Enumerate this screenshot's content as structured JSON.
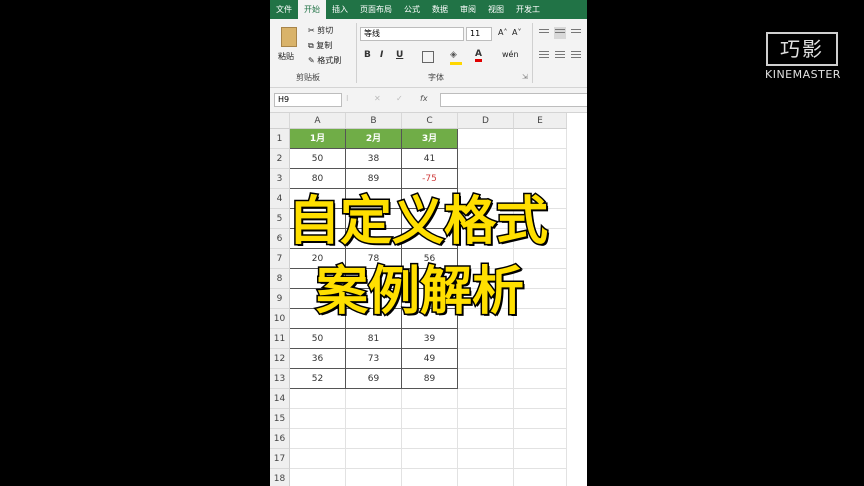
{
  "ribbon": {
    "tabs": [
      "文件",
      "开始",
      "插入",
      "页面布局",
      "公式",
      "数据",
      "审阅",
      "视图",
      "开发工"
    ],
    "active_tab": "开始",
    "clipboard": {
      "paste": "粘贴",
      "cut": "剪切",
      "copy": "复制",
      "format_painter": "格式刷",
      "group_label": "剪贴板"
    },
    "font": {
      "name": "等线",
      "size": "11",
      "group_label": "字体",
      "bold": "B",
      "italic": "I",
      "underline": "U",
      "fx_color": "A"
    },
    "accent_color": "#217346"
  },
  "formula_bar": {
    "name_box": "H9",
    "fx": "fx",
    "cancel": "✕",
    "enter": "✓"
  },
  "grid": {
    "columns": [
      "A",
      "B",
      "C",
      "D",
      "E"
    ],
    "rows": [
      "1",
      "2",
      "3",
      "4",
      "5",
      "6",
      "7",
      "8",
      "9",
      "10",
      "11",
      "12",
      "13",
      "14",
      "15",
      "16",
      "17",
      "18"
    ],
    "header": [
      "1月",
      "2月",
      "3月"
    ],
    "header_color": "#70ad47",
    "cells": [
      [
        "50",
        "38",
        "41"
      ],
      [
        "80",
        "89",
        "-75"
      ],
      [
        "",
        "",
        ""
      ],
      [
        "",
        "",
        ""
      ],
      [
        "",
        "",
        ""
      ],
      [
        "20",
        "78",
        "56"
      ],
      [
        "",
        "",
        ""
      ],
      [
        "",
        "",
        ""
      ],
      [
        "",
        "",
        ""
      ],
      [
        "50",
        "81",
        "39"
      ],
      [
        "36",
        "73",
        "49"
      ],
      [
        "52",
        "69",
        "89"
      ]
    ]
  },
  "overlay": {
    "line1": "自定义格式",
    "line2": "案例解析"
  },
  "watermark": {
    "logo": "巧影",
    "text": "KINEMASTER"
  }
}
